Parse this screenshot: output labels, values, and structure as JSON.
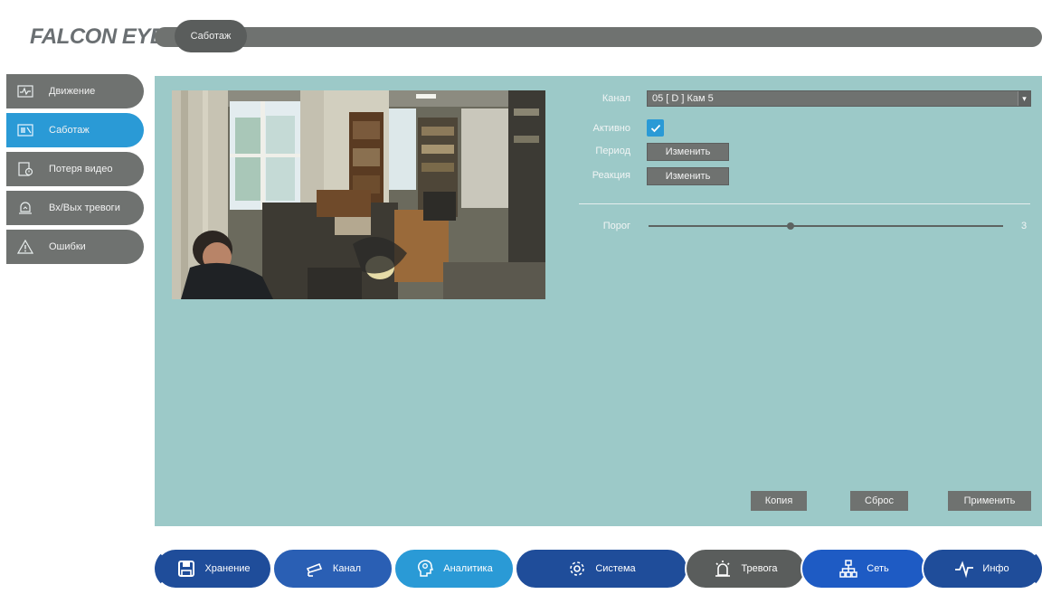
{
  "brand": {
    "logo_main": "FALCON",
    "logo_tail": "EYE"
  },
  "header": {
    "title": "Саботаж"
  },
  "sidebar": {
    "items": [
      {
        "label": "Движение",
        "icon": "motion-graph-icon",
        "active": false
      },
      {
        "label": "Саботаж",
        "icon": "tamper-icon",
        "active": true
      },
      {
        "label": "Потеря видео",
        "icon": "video-loss-icon",
        "active": false
      },
      {
        "label": "Вх/Вых тревоги",
        "icon": "alarm-io-icon",
        "active": false
      },
      {
        "label": "Ошибки",
        "icon": "warning-icon",
        "active": false
      }
    ]
  },
  "form": {
    "channel_label": "Канал",
    "channel_value": "05 [ D ] Кам 5",
    "active_label": "Активно",
    "active_checked": true,
    "period_label": "Период",
    "period_button": "Изменить",
    "reaction_label": "Реакция",
    "reaction_button": "Изменить",
    "threshold_label": "Порог",
    "threshold_value": "3",
    "threshold_fraction": 0.4
  },
  "actions": {
    "copy": "Копия",
    "reset": "Сброс",
    "apply": "Применить"
  },
  "bottom_nav": {
    "tabs": [
      {
        "label": "Хранение",
        "icon": "storage-disk-icon",
        "color": "#1f4d9a"
      },
      {
        "label": "Канал",
        "icon": "camera-icon",
        "color": "#2a5fb4"
      },
      {
        "label": "Аналитика",
        "icon": "analytics-head-icon",
        "color": "#2a9ad6"
      },
      {
        "label": "Система",
        "icon": "gear-icon",
        "color": "#1f4d9a"
      },
      {
        "label": "Тревога",
        "icon": "alarm-icon",
        "color": "#5a5d5c"
      },
      {
        "label": "Сеть",
        "icon": "network-icon",
        "color": "#1e5bc4"
      },
      {
        "label": "Инфо",
        "icon": "pulse-icon",
        "color": "#1f4d9a"
      }
    ]
  },
  "colors": {
    "accent": "#2a9ad6",
    "panel": "#9cc9c8",
    "gray_control": "#6f7270"
  }
}
